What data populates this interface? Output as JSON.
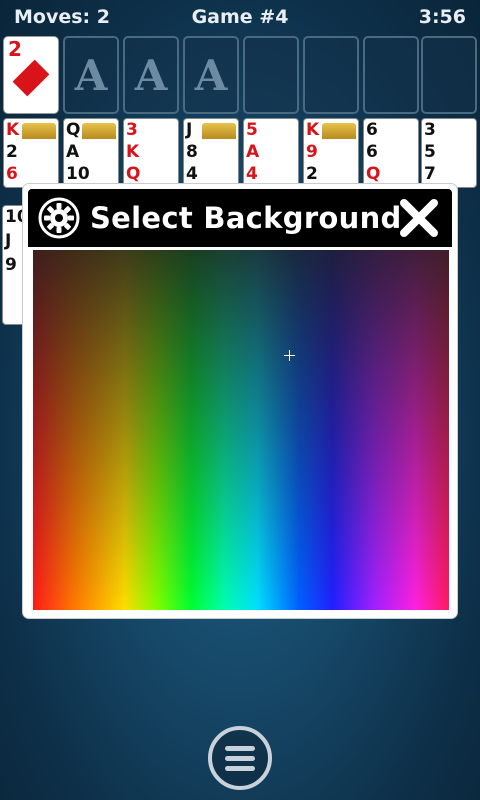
{
  "status": {
    "moves": "Moves: 2",
    "game": "Game #4",
    "time": "3:56"
  },
  "freecell": {
    "rank": "2",
    "suit": "diamond"
  },
  "foundations": [
    "A",
    "A",
    "A"
  ],
  "tableau_top": [
    {
      "rank": "K",
      "color": "red"
    },
    {
      "rank": "Q",
      "color": "black"
    },
    {
      "rank": "3",
      "color": "red"
    },
    {
      "rank": "J",
      "color": "black"
    },
    {
      "rank": "5",
      "color": "red"
    },
    {
      "rank": "K",
      "color": "red"
    },
    {
      "rank": "6",
      "color": "black"
    },
    {
      "rank": "3",
      "color": "black"
    }
  ],
  "tableau_second": [
    {
      "rank": "2",
      "color": "black"
    },
    {
      "rank": "A",
      "color": "black"
    },
    {
      "rank": "K",
      "color": "red"
    },
    {
      "rank": "8",
      "color": "black"
    },
    {
      "rank": "A",
      "color": "red"
    },
    {
      "rank": "9",
      "color": "red"
    },
    {
      "rank": "6",
      "color": "black"
    },
    {
      "rank": "5",
      "color": "black"
    }
  ],
  "tableau_third": [
    {
      "rank": "6",
      "color": "red"
    },
    {
      "rank": "10",
      "color": "black"
    },
    {
      "rank": "Q",
      "color": "red"
    },
    {
      "rank": "4",
      "color": "black"
    },
    {
      "rank": "4",
      "color": "red"
    },
    {
      "rank": "2",
      "color": "black"
    },
    {
      "rank": "Q",
      "color": "red"
    },
    {
      "rank": "7",
      "color": "black"
    }
  ],
  "left_peek": [
    "10",
    "J",
    "9"
  ],
  "dialog": {
    "title": "Select Background"
  },
  "colors": {
    "background": "#164868",
    "dialog_header": "#000000",
    "red_suit": "#d8141a"
  }
}
